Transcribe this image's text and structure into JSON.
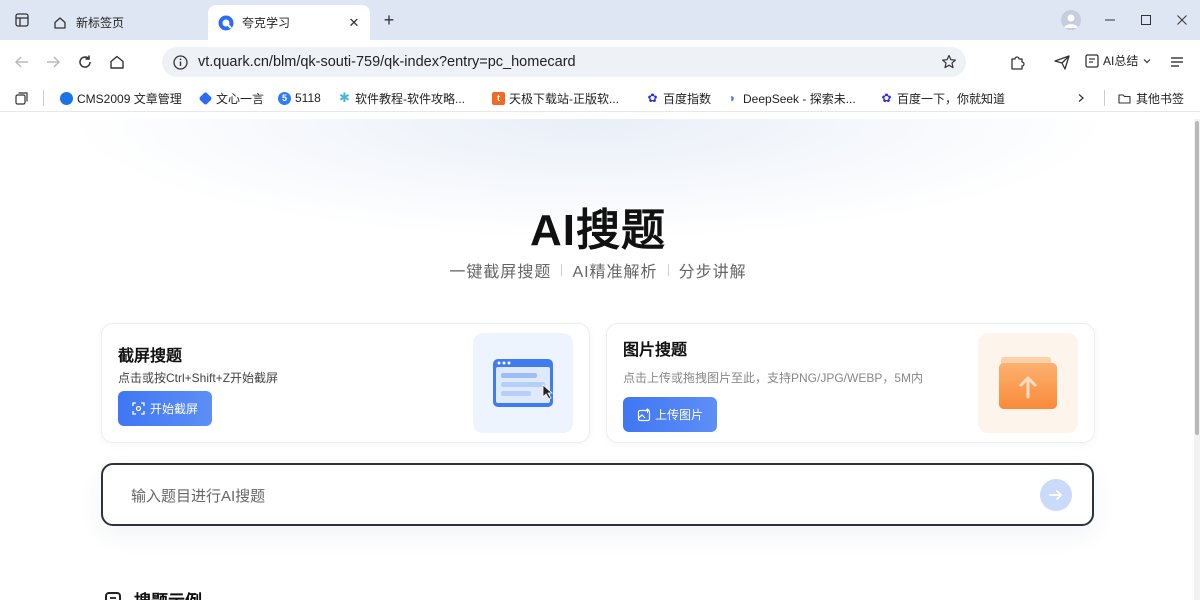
{
  "tabs": [
    {
      "label": "新标签页",
      "active": false
    },
    {
      "label": "夸克学习",
      "active": true
    }
  ],
  "address": {
    "url": "vt.quark.cn/blm/qk-souti-759/qk-index?entry=pc_homecard"
  },
  "toolbar": {
    "ai_summary_label": "AI总结"
  },
  "bookmarks": [
    {
      "label": "CMS2009 文章管理",
      "icon": "cms-icon",
      "color": "#1a73e8"
    },
    {
      "label": "文心一言",
      "icon": "wenxin-icon",
      "color": "#2b6cf5"
    },
    {
      "label": "5118",
      "icon": "5118-icon",
      "color": "#2f7cf6"
    },
    {
      "label": "软件教程-软件攻略...",
      "icon": "star-bookmark-icon",
      "color": "#46b8d8"
    },
    {
      "label": "天极下载站-正版软...",
      "icon": "tianji-icon",
      "color": "#f26a21"
    },
    {
      "label": "百度指数",
      "icon": "baidu-icon",
      "color": "#2932e1"
    },
    {
      "label": "DeepSeek - 探索未...",
      "icon": "deepseek-icon",
      "color": "#4d6bfe"
    },
    {
      "label": "百度一下，你就知道",
      "icon": "baidu-icon",
      "color": "#2932e1"
    }
  ],
  "other_bookmarks": "其他书签",
  "hero": {
    "title": "AI搜题",
    "features": [
      "一键截屏搜题",
      "AI精准解析",
      "分步讲解"
    ]
  },
  "cards": {
    "screenshot": {
      "title": "截屏搜题",
      "desc": "点击或按Ctrl+Shift+Z开始截屏",
      "button": "开始截屏"
    },
    "image": {
      "title": "图片搜题",
      "desc": "点击上传或拖拽图片至此，支持PNG/JPG/WEBP，5M内",
      "button": "上传图片"
    }
  },
  "search": {
    "placeholder": "输入题目进行AI搜题"
  },
  "section": {
    "title": "搜题示例"
  },
  "colors": {
    "accent": "#3f76f4",
    "tabbar": "#dfe6f3",
    "send_btn": "#c9dafa"
  }
}
